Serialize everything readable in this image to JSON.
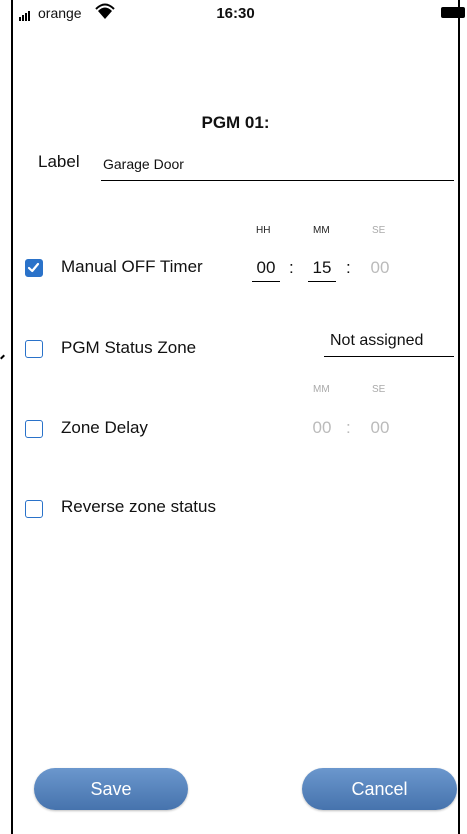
{
  "status_bar": {
    "carrier": "orange",
    "time": "16:30"
  },
  "header": {
    "title": "PGM 01:"
  },
  "label_field": {
    "caption": "Label",
    "value": "Garage Door"
  },
  "manual_off_timer": {
    "label": "Manual OFF Timer",
    "checked": true,
    "headers": [
      "HH",
      "MM",
      "SE"
    ],
    "hh": "00",
    "mm": "15",
    "se": "00",
    "separator": ":"
  },
  "pgm_status_zone": {
    "label": "PGM Status Zone",
    "checked": false,
    "value": "Not assigned"
  },
  "zone_delay": {
    "label": "Zone Delay",
    "checked": false,
    "headers": [
      "MM",
      "SE"
    ],
    "mm": "00",
    "se": "00",
    "separator": ":"
  },
  "reverse_zone_status": {
    "label": "Reverse zone status",
    "checked": false
  },
  "buttons": {
    "save": "Save",
    "cancel": "Cancel"
  },
  "colors": {
    "accent": "#2a72c9",
    "button": "#5682bd",
    "disabled_text": "#bbbbbb"
  }
}
